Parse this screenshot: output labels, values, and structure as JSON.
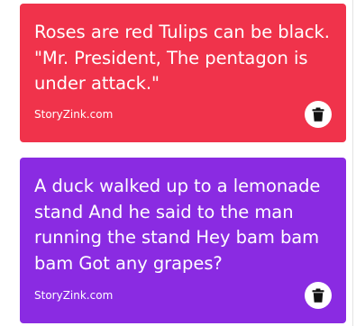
{
  "colors": {
    "card_red": "#f0334b",
    "card_purple": "#8a2be2",
    "icon_dark": "#111111"
  },
  "cards": [
    {
      "quote": "Roses are red Tulips can be black. \"Mr. President, The pentagon is under attack.\"",
      "source": "StoryZink.com",
      "delete_icon": "trash-icon"
    },
    {
      "quote": "A duck walked up to a lemonade stand And he said to the man running the stand Hey bam bam bam Got any grapes?",
      "source": "StoryZink.com",
      "delete_icon": "trash-icon"
    }
  ]
}
